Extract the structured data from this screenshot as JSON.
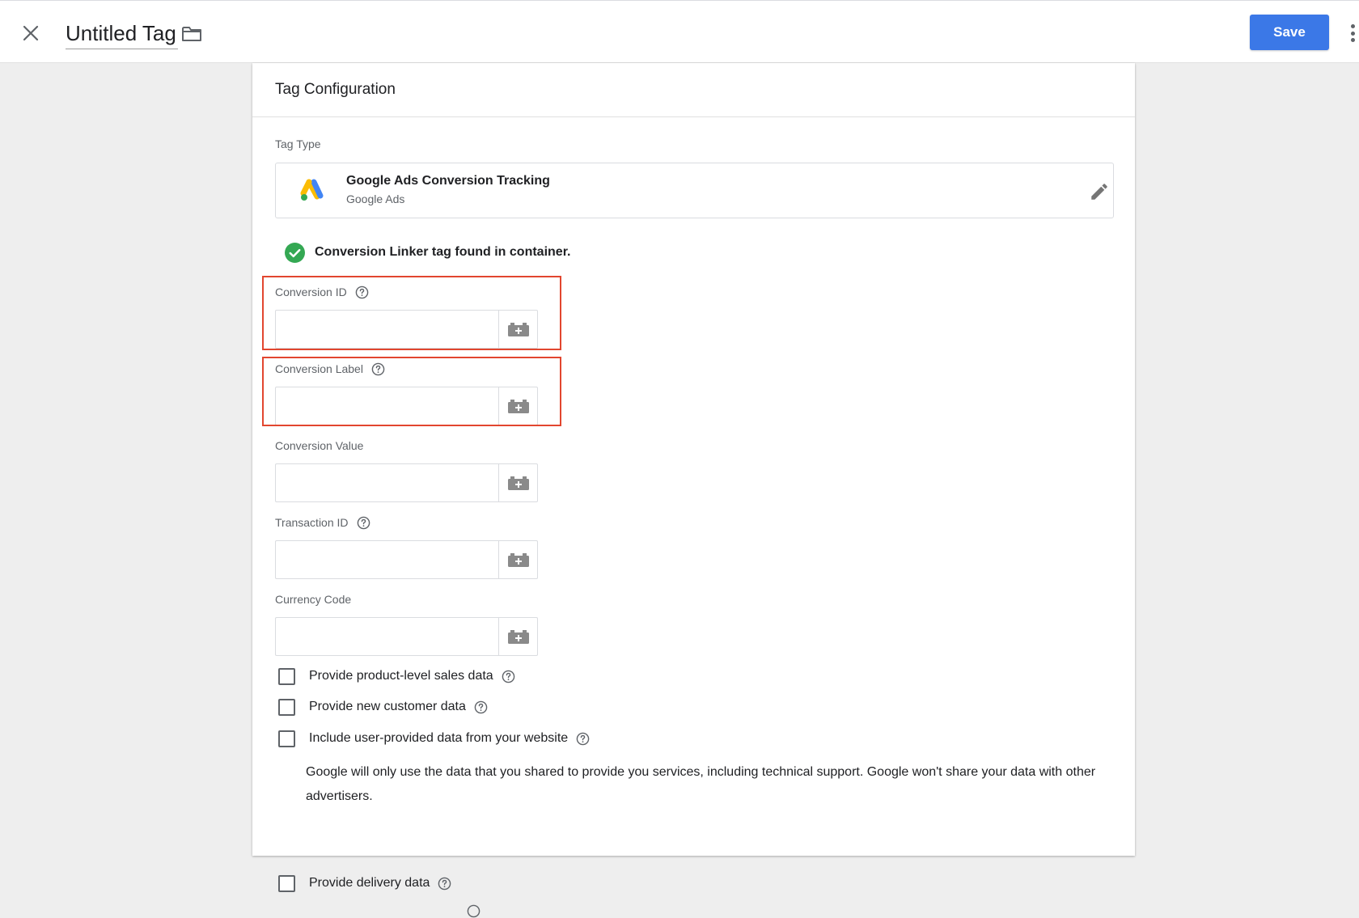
{
  "header": {
    "title": "Untitled Tag",
    "save_label": "Save"
  },
  "card": {
    "title": "Tag Configuration",
    "tag_type_label": "Tag Type",
    "tag_type": {
      "name": "Google Ads Conversion Tracking",
      "provider": "Google Ads"
    },
    "linker_status": "Conversion Linker tag found in container."
  },
  "fields": [
    {
      "label": "Conversion ID",
      "value": "",
      "has_help": true,
      "highlighted": true
    },
    {
      "label": "Conversion Label",
      "value": "",
      "has_help": true,
      "highlighted": true
    },
    {
      "label": "Conversion Value",
      "value": "",
      "has_help": false,
      "highlighted": false
    },
    {
      "label": "Transaction ID",
      "value": "",
      "has_help": true,
      "highlighted": false
    },
    {
      "label": "Currency Code",
      "value": "",
      "has_help": false,
      "highlighted": false
    }
  ],
  "checkboxes": [
    {
      "label": "Provide product-level sales data",
      "checked": false
    },
    {
      "label": "Provide new customer data",
      "checked": false
    },
    {
      "label": "Include user-provided data from your website",
      "checked": false
    },
    {
      "label": "Provide delivery data",
      "checked": false
    }
  ],
  "user_data_note": "Google will only use the data that you shared to provide you services, including technical support. Google won't share your data with other advertisers.",
  "icons": {
    "close": "close-icon",
    "folder": "folder-icon",
    "more": "more-vert-icon",
    "edit": "pencil-icon",
    "help": "help-circle-icon",
    "variable": "variable-brick-icon",
    "check": "check-circle-icon",
    "logo": "google-ads-logo"
  },
  "colors": {
    "primary": "#3b78e7",
    "highlight": "#e2462f",
    "success": "#34a853"
  }
}
